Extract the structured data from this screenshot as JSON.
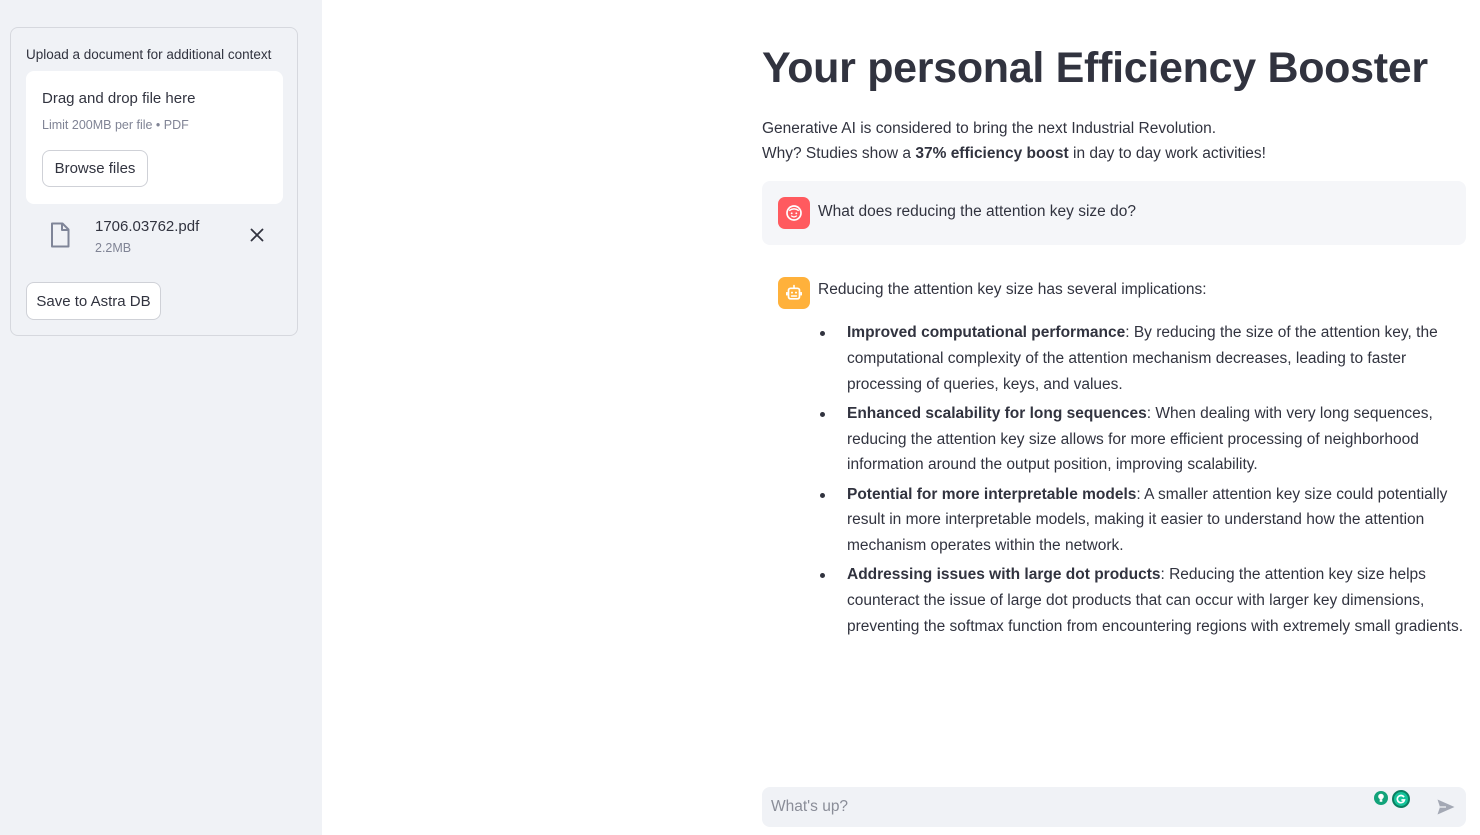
{
  "sidebar": {
    "upload_label": "Upload a document for additional context",
    "dropzone": {
      "title": "Drag and drop file here",
      "limit": "Limit 200MB per file • PDF",
      "browse_label": "Browse files"
    },
    "uploaded_file": {
      "name": "1706.03762.pdf",
      "size": "2.2MB",
      "icon": "file-icon",
      "remove_icon": "close-icon"
    },
    "save_label": "Save to Astra DB"
  },
  "main": {
    "title": "Your personal Efficiency Booster",
    "intro_line1": "Generative AI is considered to bring the next Industrial Revolution.",
    "intro_line2_prefix": "Why? Studies show a ",
    "intro_line2_bold": "37% efficiency boost",
    "intro_line2_suffix": " in day to day work activities!",
    "messages": {
      "user": {
        "avatar_icon": "user-face-icon",
        "text": "What does reducing the attention key size do?"
      },
      "assistant": {
        "avatar_icon": "robot-icon",
        "intro": "Reducing the attention key size has several implications:",
        "items": [
          {
            "title": "Improved computational performance",
            "body": ": By reducing the size of the attention key, the computational complexity of the attention mechanism decreases, leading to faster processing of queries, keys, and values."
          },
          {
            "title": "Enhanced scalability for long sequences",
            "body": ": When dealing with very long sequences, reducing the attention key size allows for more efficient processing of neighborhood information around the output position, improving scalability."
          },
          {
            "title": "Potential for more interpretable models",
            "body": ": A smaller attention key size could potentially result in more interpretable models, making it easier to understand how the attention mechanism operates within the network."
          },
          {
            "title": "Addressing issues with large dot products",
            "body": ": Reducing the attention key size helps counteract the issue of large dot products that can occur with larger key dimensions, preventing the softmax function from encountering regions with extremely small gradients."
          }
        ]
      }
    },
    "chat_input": {
      "placeholder": "What's up?",
      "send_icon": "send-icon"
    }
  },
  "colors": {
    "sidebar_bg": "#f0f2f6",
    "text": "#31333f",
    "user_avatar": "#ff5a5f",
    "assistant_avatar": "#ffb13b",
    "user_message_bg": "#f5f6f9"
  }
}
